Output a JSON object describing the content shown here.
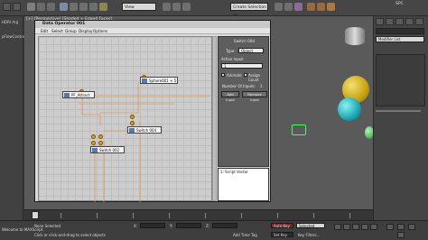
{
  "toolbar": {
    "view_combo": "View",
    "create_selection_placeholder": "Create Selection Se",
    "user": "SPC",
    "icons": [
      "undo-icon",
      "redo-icon",
      "link-icon",
      "unlink-icon",
      "bind-icon",
      "select-icon",
      "move-icon",
      "rotate-icon",
      "scale-icon",
      "snap-icon",
      "mirror-icon",
      "align-icon",
      "material-icon",
      "render-icon"
    ]
  },
  "left_panel": {
    "item_1": "HDRI Arg",
    "item_2": "pFlowControl"
  },
  "viewport": {
    "label": "[+] [Perspective] [Shaded + Edged Faces]",
    "colors": {
      "yellow_ball": "#c9a311",
      "cyan_ball": "#1aa8b3",
      "green_ball": "#5cbf6b",
      "gizmo": "#40ff60"
    }
  },
  "right_panel": {
    "modifier_list": "Modifier List"
  },
  "dialog": {
    "title": "Data Operator 001",
    "menu": [
      "Edit",
      "Select",
      "Group",
      "Display",
      "Options"
    ],
    "nodes": {
      "pf_attract": "PF_Attract",
      "sphere": "Sphere001 + 5",
      "switch_004": "Switch 004",
      "switch_002": "Switch 002"
    },
    "properties": {
      "title": "Switch 004",
      "type_label": "Type:",
      "type_value": "Object",
      "active_input_label": "Active Input:",
      "active_input_value": "1",
      "animate_label": "Animate",
      "animate2_label": "Assign Count",
      "number_of_inputs_label": "Number Of Inputs:",
      "number_of_inputs_value": "1",
      "add_input": "Add Input",
      "remove_input": "Remove Input"
    },
    "script_text": "1: Script Vector"
  },
  "timeline": {
    "frame_marker": "0"
  },
  "status": {
    "left_text": "None Selected",
    "hint_text": "Click or click-and-drag to select objects",
    "x_label": "X:",
    "y_label": "Y:",
    "z_label": "Z:",
    "auto_key": "Auto Key",
    "selected": "Selected",
    "set_key": "Set Key",
    "key_filters": "Key Filters...",
    "add_time_tag": "Add Time Tag",
    "welcome": "Welcome to MAXScript"
  }
}
